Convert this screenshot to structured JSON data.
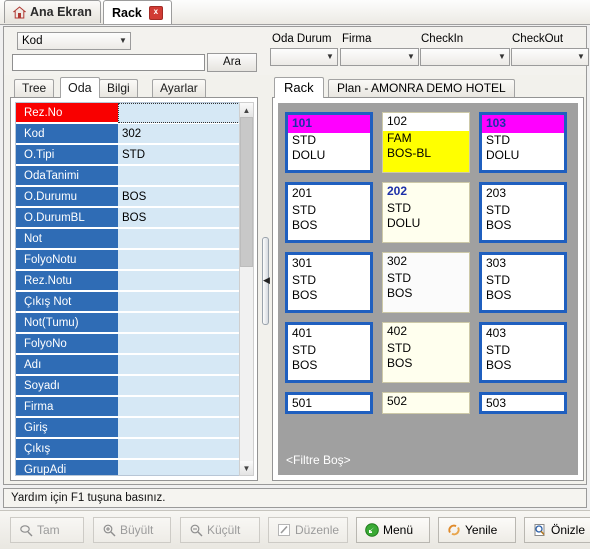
{
  "window": {
    "doc_tabs": [
      {
        "label": "Ana Ekran",
        "icon": "home-icon",
        "active": false
      },
      {
        "label": "Rack",
        "icon": "none",
        "active": true,
        "close": "x"
      }
    ]
  },
  "filterbar": {
    "kod_combo": {
      "value": "Kod"
    },
    "search_input": {
      "value": "",
      "placeholder": ""
    },
    "search_button": "Ara",
    "fields": [
      {
        "label": "Oda Durum",
        "value": ""
      },
      {
        "label": "Firma",
        "value": ""
      },
      {
        "label": "CheckIn",
        "value": ""
      },
      {
        "label": "CheckOut",
        "value": ""
      }
    ]
  },
  "left_pane": {
    "tabs": [
      {
        "label": "Tree",
        "selected": false
      },
      {
        "label": "Oda",
        "selected": true
      },
      {
        "label": "Bilgi",
        "selected": false
      },
      {
        "label": "Ayarlar",
        "selected": false
      }
    ],
    "grid_rows": [
      {
        "name": "Rez.No",
        "value": "",
        "selected": true
      },
      {
        "name": "Kod",
        "value": "302",
        "selected": false
      },
      {
        "name": "O.Tipi",
        "value": "STD",
        "selected": false
      },
      {
        "name": "OdaTanimi",
        "value": "",
        "selected": false
      },
      {
        "name": "O.Durumu",
        "value": "BOS",
        "selected": false
      },
      {
        "name": "O.DurumBL",
        "value": "BOS",
        "selected": false
      },
      {
        "name": "Not",
        "value": "",
        "selected": false
      },
      {
        "name": "FolyoNotu",
        "value": "",
        "selected": false
      },
      {
        "name": "Rez.Notu",
        "value": "",
        "selected": false
      },
      {
        "name": "Çıkış Not",
        "value": "",
        "selected": false
      },
      {
        "name": "Not(Tumu)",
        "value": "",
        "selected": false
      },
      {
        "name": "FolyoNo",
        "value": "",
        "selected": false
      },
      {
        "name": "Adı",
        "value": "",
        "selected": false
      },
      {
        "name": "Soyadı",
        "value": "",
        "selected": false
      },
      {
        "name": "Firma",
        "value": "",
        "selected": false
      },
      {
        "name": "Giriş",
        "value": "",
        "selected": false
      },
      {
        "name": "Çıkış",
        "value": "",
        "selected": false
      },
      {
        "name": "GrupAdi",
        "value": "",
        "selected": false
      }
    ],
    "scroll_up": "▲",
    "scroll_down": "▼"
  },
  "right_pane": {
    "tabs": [
      {
        "label": "Rack",
        "selected": true
      },
      {
        "label": "Plan - AMONRA DEMO HOTEL",
        "selected": false
      }
    ],
    "rack_rows": [
      [
        {
          "no": "101",
          "type": "STD",
          "status": "DOLU",
          "style": "hdr-magenta"
        },
        {
          "no": "102",
          "type": "FAM",
          "status": "BOS-BL",
          "style": "body-yellow softborder"
        },
        {
          "no": "103",
          "type": "STD",
          "status": "DOLU",
          "style": "hdr-magenta"
        }
      ],
      [
        {
          "no": "201",
          "type": "STD",
          "status": "BOS",
          "style": ""
        },
        {
          "no": "202",
          "type": "STD",
          "status": "DOLU",
          "style": "hdr-magenta bg-cream softborder"
        },
        {
          "no": "203",
          "type": "STD",
          "status": "BOS",
          "style": ""
        }
      ],
      [
        {
          "no": "301",
          "type": "STD",
          "status": "BOS",
          "style": ""
        },
        {
          "no": "302",
          "type": "STD",
          "status": "BOS",
          "style": "bg-white2 softborder"
        },
        {
          "no": "303",
          "type": "STD",
          "status": "BOS",
          "style": ""
        }
      ],
      [
        {
          "no": "401",
          "type": "STD",
          "status": "BOS",
          "style": ""
        },
        {
          "no": "402",
          "type": "STD",
          "status": "BOS",
          "style": "bg-cream softborder"
        },
        {
          "no": "403",
          "type": "STD",
          "status": "BOS",
          "style": ""
        }
      ],
      [
        {
          "no": "501",
          "type": "",
          "status": "",
          "style": "clip"
        },
        {
          "no": "502",
          "type": "",
          "status": "",
          "style": "clip bg-cream softborder"
        },
        {
          "no": "503",
          "type": "",
          "status": "",
          "style": "clip"
        }
      ]
    ],
    "filter_footer": "<Filtre Boş>"
  },
  "status_bar": {
    "text": "Yardım için F1 tuşuna basınız."
  },
  "toolbar": {
    "buttons": [
      {
        "id": "tam",
        "label": "Tam",
        "icon": "zoom-fit-icon",
        "disabled": true
      },
      {
        "id": "buyult",
        "label": "Büyült",
        "icon": "zoom-in-icon",
        "disabled": true
      },
      {
        "id": "kucult",
        "label": "Küçült",
        "icon": "zoom-out-icon",
        "disabled": true
      },
      {
        "id": "duzenle",
        "label": "Düzenle",
        "icon": "edit-pencil-icon",
        "disabled": true
      },
      {
        "id": "menu",
        "label": "Menü",
        "icon": "green-arrow-icon",
        "disabled": false
      },
      {
        "id": "yenile",
        "label": "Yenile",
        "icon": "refresh-icon",
        "disabled": false
      },
      {
        "id": "onizle",
        "label": "Önizle",
        "icon": "preview-icon",
        "disabled": false
      }
    ]
  },
  "colors": {
    "magenta": "#ff00ff",
    "yellow": "#ffff00",
    "card_border_blue": "#1f5fbf",
    "grid_name_blue": "#2f6cb5",
    "grid_selected_red": "#f90000",
    "rack_bg_gray": "#a0a0a0"
  }
}
